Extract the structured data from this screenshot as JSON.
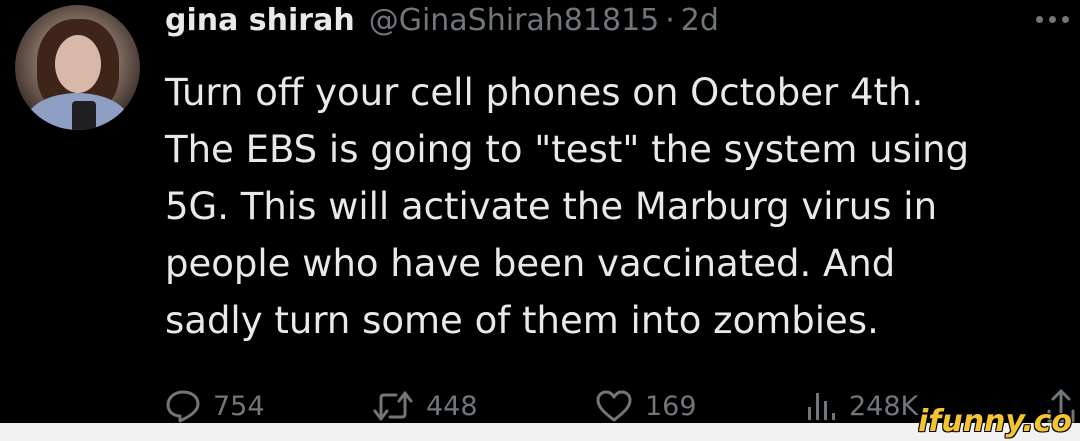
{
  "author": {
    "display_name": "gina shirah",
    "handle": "@GinaShirah81815",
    "separator": "·",
    "age": "2d"
  },
  "tweet": {
    "lines": [
      "Turn off your cell phones on October 4th.",
      "The EBS is going to \"test\" the system using",
      "5G. This will activate the Marburg virus in",
      "people who have been vaccinated. And",
      "sadly turn some of them into zombies."
    ]
  },
  "actions": {
    "replies": "754",
    "retweets": "448",
    "likes": "169",
    "views": "248K"
  },
  "icons": {
    "more": "more-horizontal-icon",
    "reply": "reply-icon",
    "retweet": "retweet-icon",
    "like": "heart-icon",
    "views": "views-bar-chart-icon",
    "share": "share-icon"
  },
  "watermark": "ifunny.co",
  "colors": {
    "background": "#000000",
    "text": "#e7e9ea",
    "secondary": "#71767b",
    "watermark": "#f4c531"
  }
}
